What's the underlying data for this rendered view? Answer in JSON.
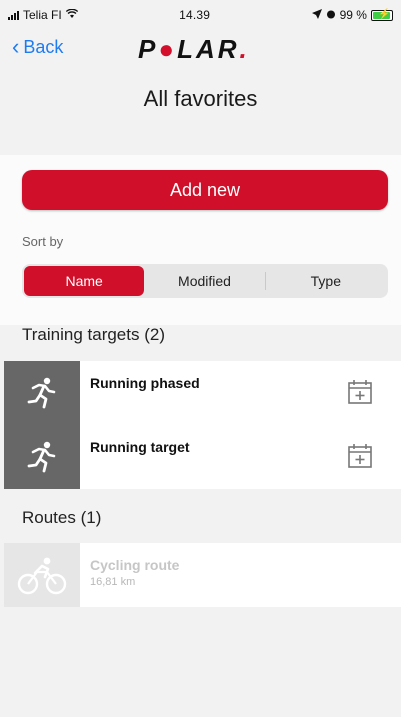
{
  "status_bar": {
    "carrier": "Telia FI",
    "time": "14.39",
    "battery": "99 %"
  },
  "nav": {
    "back_label": "Back",
    "logo_text": "POLAR"
  },
  "page": {
    "title": "All favorites"
  },
  "actions": {
    "add_new_label": "Add new"
  },
  "sort": {
    "label": "Sort by",
    "options": [
      "Name",
      "Modified",
      "Type"
    ],
    "selected": "Name"
  },
  "sections": {
    "training_targets": {
      "title": "Training targets (2)",
      "items": [
        {
          "name": "Running phased",
          "icon": "running-icon"
        },
        {
          "name": "Running target",
          "icon": "running-icon"
        }
      ]
    },
    "routes": {
      "title": "Routes (1)",
      "items": [
        {
          "name": "Cycling route",
          "distance": "16,81 km",
          "icon": "cycling-icon"
        }
      ]
    }
  },
  "colors": {
    "accent": "#d0102a",
    "link": "#1e7cf2",
    "thumb_dark": "#676767"
  }
}
